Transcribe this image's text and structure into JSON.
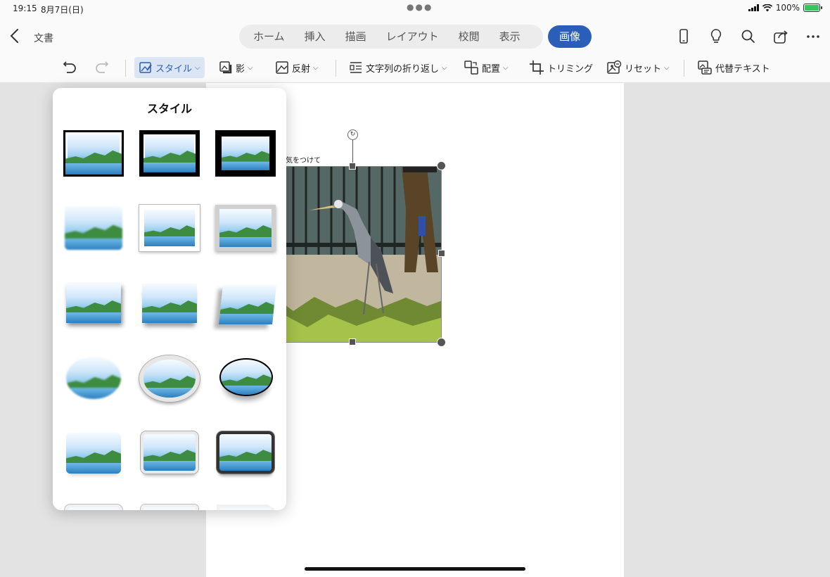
{
  "status": {
    "time": "19:15",
    "date": "8月7日(日)",
    "battery": "100%",
    "battery_level": 1.0
  },
  "header": {
    "doc_title": "文書",
    "tabs": [
      {
        "label": "ホーム"
      },
      {
        "label": "挿入"
      },
      {
        "label": "描画"
      },
      {
        "label": "レイアウト"
      },
      {
        "label": "校閲"
      },
      {
        "label": "表示"
      }
    ],
    "active_tab": "画像",
    "icons": [
      "phone-icon",
      "lightbulb-icon",
      "search-icon",
      "share-icon",
      "more-icon"
    ]
  },
  "ribbon": {
    "style": "スタイル",
    "shadow": "影",
    "reflection": "反射",
    "wrap": "文字列の折り返し",
    "arrange": "配置",
    "crop": "トリミング",
    "reset": "リセット",
    "alt_text": "代替テキスト"
  },
  "document": {
    "text": "気をつけて"
  },
  "popover": {
    "title": "スタイル",
    "styles": [
      "frame-thin-black",
      "frame-double-black",
      "frame-thick-black",
      "soft-edge",
      "frame-white",
      "frame-gray-bevel",
      "shadow-drop",
      "shadow-bottom",
      "perspective",
      "oval-soft",
      "oval-frame-silver",
      "oval-black-shadow",
      "rounded-soft",
      "rounded-frame-silver",
      "rounded-frame-dark",
      "partial-1",
      "partial-2",
      "partial-3"
    ]
  },
  "colors": {
    "accent": "#2b5eb8",
    "ribbon_selected_bg": "#dbe5f3",
    "panel_bg": "#e3e3e3"
  }
}
